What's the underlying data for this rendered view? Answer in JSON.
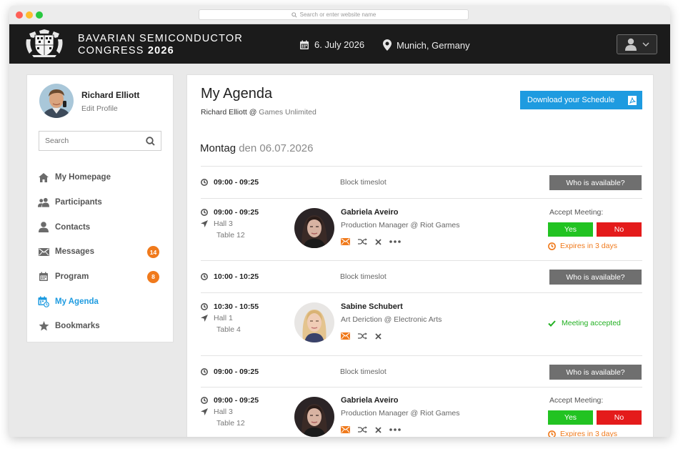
{
  "browser": {
    "url_placeholder": "Search or enter website name"
  },
  "header": {
    "brand_line1": "BAVARIAN SEMICONDUCTOR",
    "brand_line2": "CONGRESS",
    "brand_year": "2026",
    "date": "6. July 2026",
    "location": "Munich, Germany"
  },
  "profile": {
    "name": "Richard Elliott",
    "edit_label": "Edit Profile"
  },
  "search": {
    "placeholder": "Search"
  },
  "nav": [
    {
      "label": "My Homepage",
      "icon": "home-icon"
    },
    {
      "label": "Participants",
      "icon": "participants-icon"
    },
    {
      "label": "Contacts",
      "icon": "contact-icon"
    },
    {
      "label": "Messages",
      "icon": "envelope-icon",
      "badge": "14"
    },
    {
      "label": "Program",
      "icon": "calendar-icon",
      "badge": "8"
    },
    {
      "label": "My Agenda",
      "icon": "agenda-icon",
      "active": true
    },
    {
      "label": "Bookmarks",
      "icon": "star-icon"
    }
  ],
  "agenda": {
    "title": "My Agenda",
    "user": "Richard Elliott",
    "at": "@",
    "company": "Games Unlimited",
    "download_label": "Download your Schedule",
    "day_name": "Montag",
    "day_date": "den 06.07.2026",
    "block_label": "Block timeslot",
    "available_label": "Who is available?",
    "accept_label": "Accept Meeting:",
    "yes_label": "Yes",
    "no_label": "No",
    "expires_label": "Expires in 3 days",
    "accepted_label": "Meeting accepted",
    "slots": [
      {
        "type": "block",
        "time": "09:00 - 09:25"
      },
      {
        "type": "meeting",
        "time": "09:00 - 09:25",
        "hall": "Hall  3",
        "table": "Table 12",
        "name": "Gabriela Aveiro",
        "role": "Production Manager @ Riot Games",
        "status": "pending"
      },
      {
        "type": "block",
        "time": "10:00 - 10:25"
      },
      {
        "type": "meeting",
        "time": "10:30 - 10:55",
        "hall": "Hall  1",
        "table": "Table 4",
        "name": "Sabine Schubert",
        "role": "Art Deriction @ Electronic Arts",
        "status": "accepted"
      },
      {
        "type": "block",
        "time": "09:00 - 09:25"
      },
      {
        "type": "meeting",
        "time": "09:00 - 09:25",
        "hall": "Hall  3",
        "table": "Table 12",
        "name": "Gabriela Aveiro",
        "role": "Production Manager @ Riot Games",
        "status": "pending"
      }
    ]
  },
  "colors": {
    "accent": "#1e9be0",
    "header_bg": "#1b1b1b",
    "yes": "#22c322",
    "no": "#e41b1b",
    "warning": "#f07a1c",
    "accepted": "#22b022",
    "badge": "#f07a1c"
  }
}
